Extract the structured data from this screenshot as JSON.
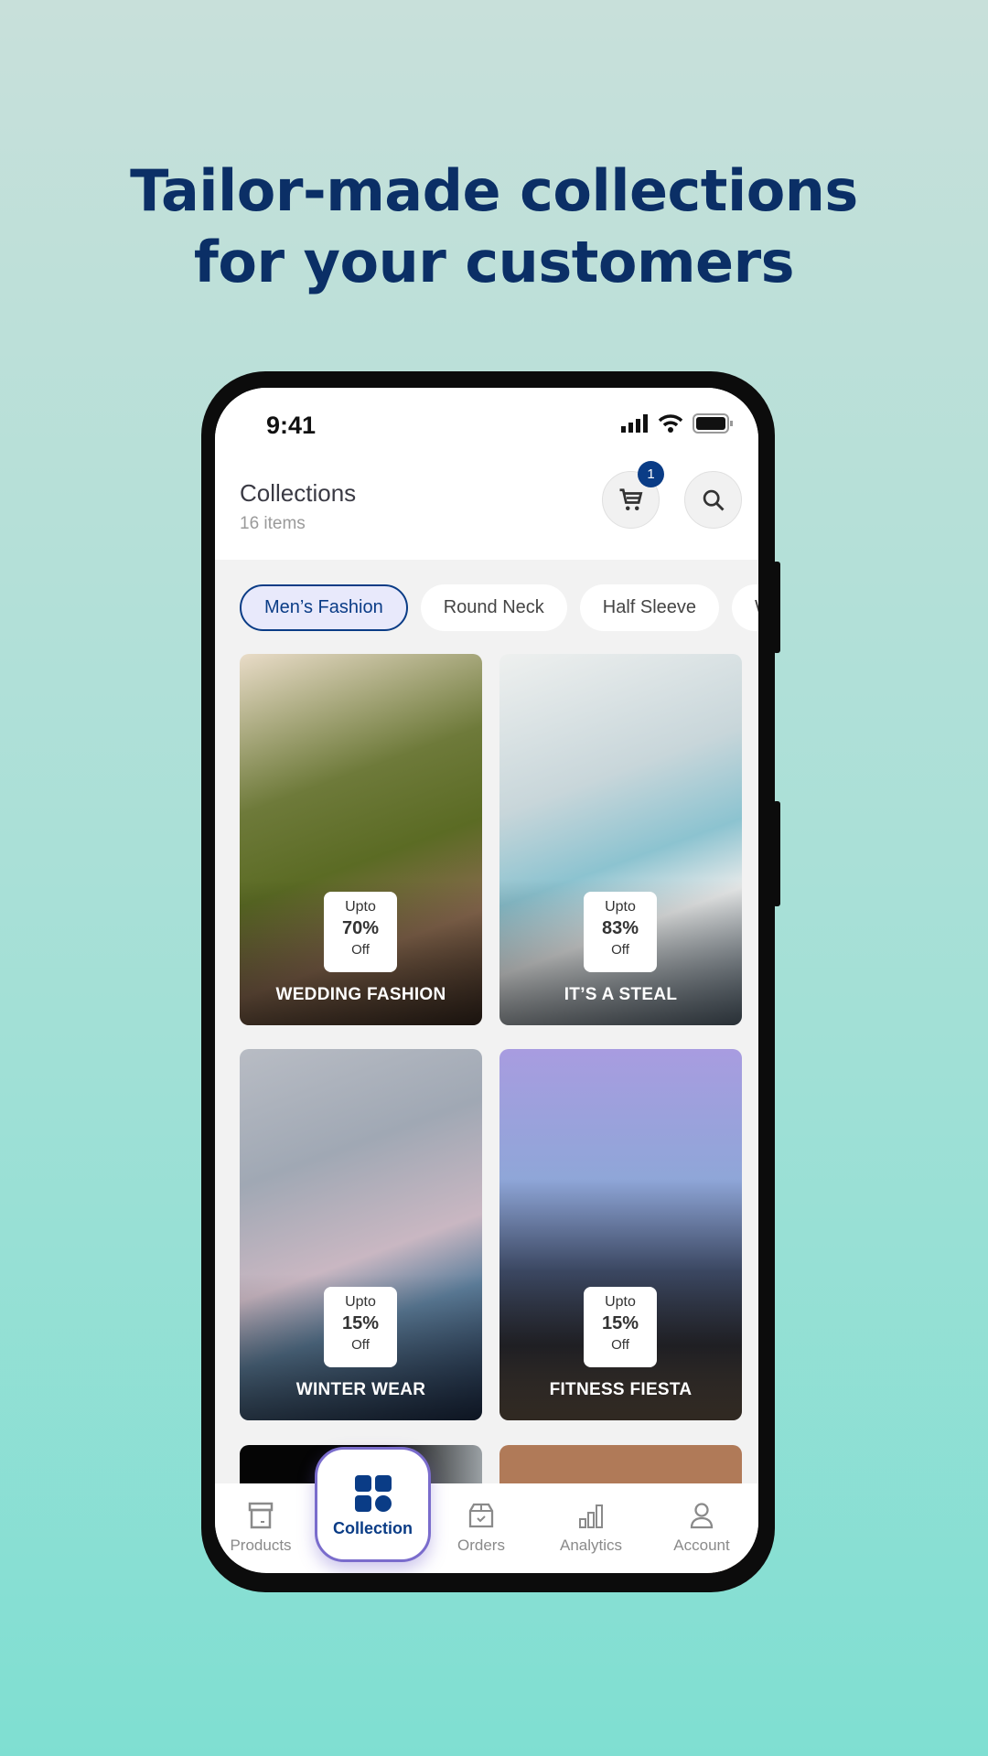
{
  "headline": {
    "line1": "Tailor-made collections",
    "line2": "for your customers"
  },
  "status_bar": {
    "time": "9:41",
    "icons": [
      "signal-icon",
      "wifi-icon",
      "battery-icon"
    ]
  },
  "header": {
    "title": "Collections",
    "subtitle": "16 items",
    "cart_count": "1"
  },
  "chips": [
    {
      "label": "Men’s Fashion",
      "active": true
    },
    {
      "label": "Round Neck"
    },
    {
      "label": "Half Sleeve"
    },
    {
      "label": "W"
    }
  ],
  "cards": [
    {
      "title": "WEDDING FASHION",
      "upto": "Upto",
      "discount": "70%",
      "off": "Off"
    },
    {
      "title": "IT’S A STEAL",
      "upto": "Upto",
      "discount": "83%",
      "off": "Off"
    },
    {
      "title": "WINTER WEAR",
      "upto": "Upto",
      "discount": "15%",
      "off": "Off"
    },
    {
      "title": "FITNESS FIESTA",
      "upto": "Upto",
      "discount": "15%",
      "off": "Off"
    }
  ],
  "nav": {
    "products": "Products",
    "collection": "Collection",
    "orders": "Orders",
    "analytics": "Analytics",
    "account": "Account",
    "active": "Collection"
  },
  "colors": {
    "accent": "#0a3c86",
    "headline": "#0b2f66",
    "highlight": "#7a6ccc"
  }
}
